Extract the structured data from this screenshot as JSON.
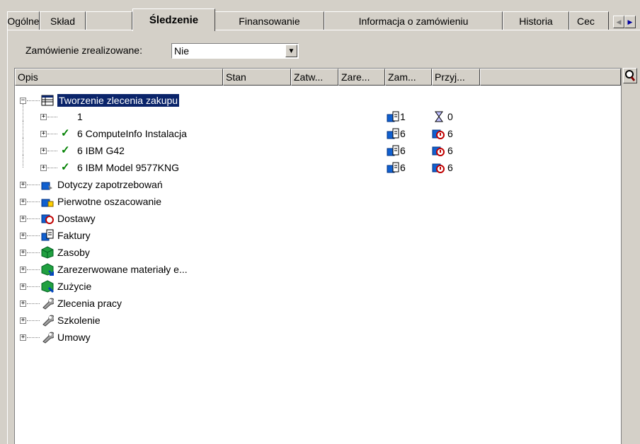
{
  "tabs": [
    "Ogólne",
    "Skład",
    "Śledzenie",
    "Finansowanie",
    "Informacja o zamówieniu",
    "Historia",
    "Cec"
  ],
  "active_tab": "Śledzenie",
  "filter": {
    "label": "Zamówienie zrealizowane:",
    "value": "Nie"
  },
  "columns": [
    "Opis",
    "Stan",
    "Zatw...",
    "Zare...",
    "Zam...",
    "Przyj..."
  ],
  "tree": {
    "root": {
      "label": "Tworzenie zlecenia zakupu",
      "icon": "table-icon",
      "children": [
        {
          "label": "1",
          "checked": false,
          "zam": "1",
          "przyj": "0",
          "przyj_icon": "hourglass-icon"
        },
        {
          "label": "6 ComputeInfo Instalacja",
          "checked": true,
          "zam": "6",
          "przyj": "6",
          "przyj_icon": "delivery-icon"
        },
        {
          "label": "6 IBM G42",
          "checked": true,
          "zam": "6",
          "przyj": "6",
          "przyj_icon": "delivery-icon"
        },
        {
          "label": "6 IBM Model 9577KNG",
          "checked": true,
          "zam": "6",
          "przyj": "6",
          "przyj_icon": "delivery-icon"
        }
      ]
    },
    "nodes": [
      {
        "label": "Dotyczy zapotrzebowań",
        "icon": "request-icon"
      },
      {
        "label": "Pierwotne oszacowanie",
        "icon": "estimate-icon"
      },
      {
        "label": "Dostawy",
        "icon": "delivery-icon"
      },
      {
        "label": "Faktury",
        "icon": "invoice-icon"
      },
      {
        "label": "Zasoby",
        "icon": "cube-icon"
      },
      {
        "label": "Zarezerwowane materiały e...",
        "icon": "reserved-icon"
      },
      {
        "label": "Zużycie",
        "icon": "consumption-icon"
      },
      {
        "label": "Zlecenia pracy",
        "icon": "wrench-icon"
      },
      {
        "label": "Szkolenie",
        "icon": "wrench-icon"
      },
      {
        "label": "Umowy",
        "icon": "wrench-icon"
      }
    ]
  }
}
